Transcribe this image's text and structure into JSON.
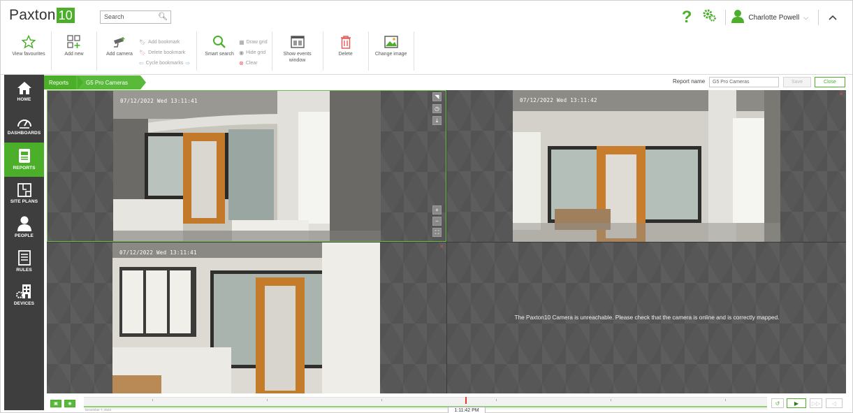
{
  "header": {
    "logo_text": "Paxton",
    "logo_number": "10",
    "search_placeholder": "Search",
    "help_label": "?",
    "user_name": "Charlotte Powell",
    "accent_color": "#4caf2a"
  },
  "toolbar": {
    "view_favourites": "View favourites",
    "add_new": "Add new",
    "add_camera": "Add camera",
    "add_bookmark": "Add bookmark",
    "delete_bookmark": "Delete bookmark",
    "cycle_bookmarks": "Cycle bookmarks",
    "smart_search": "Smart search",
    "draw_grid": "Draw grid",
    "hide_grid": "Hide grid",
    "clear": "Clear",
    "show_events_window": "Show events window",
    "delete": "Delete",
    "change_image": "Change image"
  },
  "sidebar": {
    "items": [
      {
        "label": "HOME",
        "icon": "home-icon"
      },
      {
        "label": "DASHBOARDS",
        "icon": "dashboard-icon"
      },
      {
        "label": "REPORTS",
        "icon": "reports-icon",
        "active": true
      },
      {
        "label": "SITE PLANS",
        "icon": "site-plans-icon"
      },
      {
        "label": "PEOPLE",
        "icon": "people-icon"
      },
      {
        "label": "RULES",
        "icon": "rules-icon"
      },
      {
        "label": "DEVICES",
        "icon": "devices-icon"
      }
    ]
  },
  "report": {
    "breadcrumb": [
      "Reports",
      "G5 Pro Cameras"
    ],
    "name_label": "Report name",
    "name_value": "G5 Pro Cameras",
    "save_label": "Save",
    "close_label": "Close"
  },
  "cameras": [
    {
      "timestamp": "07/12/2022 Wed 13:11:41"
    },
    {
      "timestamp": "07/12/2022 Wed 13:11:42"
    },
    {
      "timestamp": "07/12/2022 Wed 13:11:41"
    },
    {
      "message": "The Paxton10 Camera is unreachable. Please check that the camera is online and is correctly mapped."
    }
  ],
  "timeline": {
    "current_time": "1:11:42 PM",
    "date": "December 7, 2022"
  }
}
